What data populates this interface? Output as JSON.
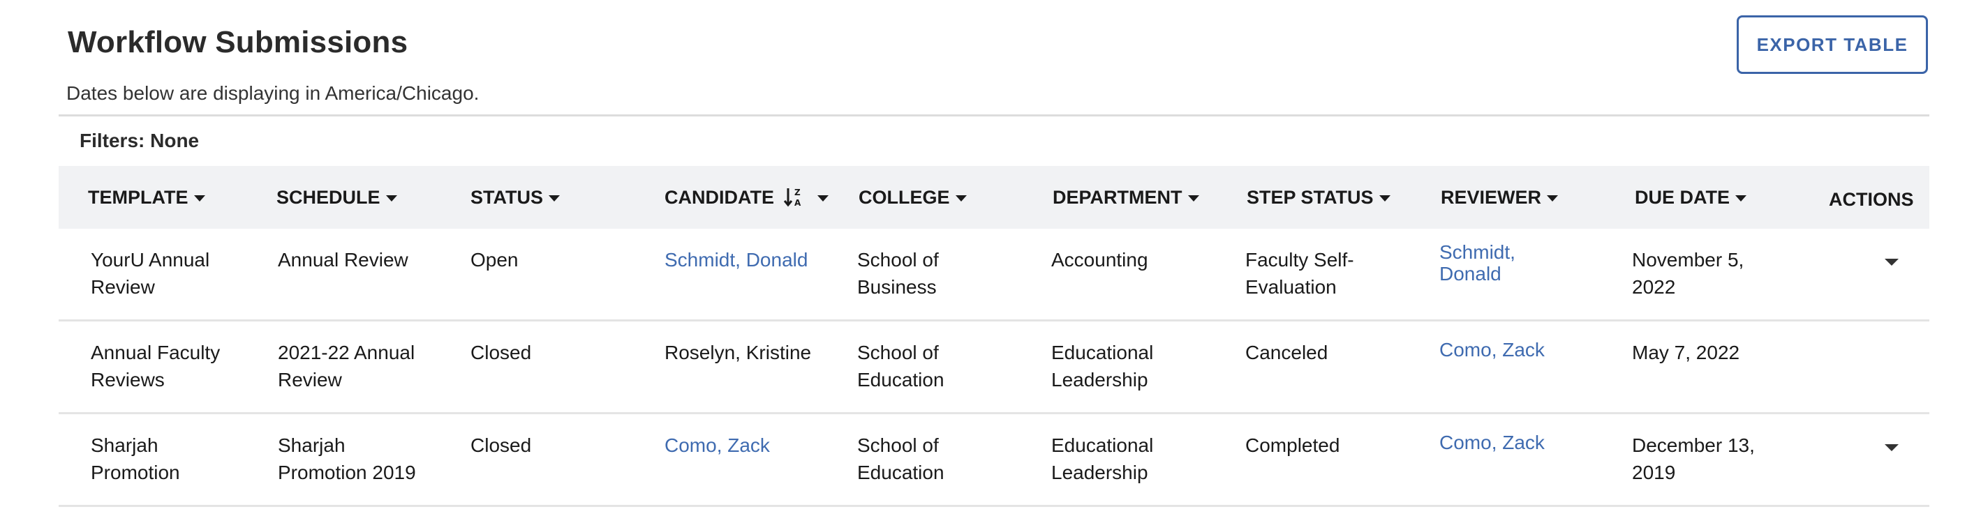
{
  "header": {
    "title": "Workflow Submissions",
    "subtitle": "Dates below are displaying in America/Chicago.",
    "export_label": "EXPORT TABLE",
    "filters_label": "Filters: None"
  },
  "table": {
    "columns": [
      {
        "key": "template",
        "label": "TEMPLATE"
      },
      {
        "key": "schedule",
        "label": "SCHEDULE"
      },
      {
        "key": "status",
        "label": "STATUS"
      },
      {
        "key": "candidate",
        "label": "CANDIDATE",
        "sort": "ascending"
      },
      {
        "key": "college",
        "label": "COLLEGE"
      },
      {
        "key": "department",
        "label": "DEPARTMENT"
      },
      {
        "key": "step_status",
        "label": "STEP STATUS"
      },
      {
        "key": "reviewer",
        "label": "REVIEWER"
      },
      {
        "key": "due_date",
        "label": "DUE DATE"
      },
      {
        "key": "actions",
        "label": "ACTIONS"
      }
    ],
    "rows": [
      {
        "template": [
          "YourU Annual",
          "Review"
        ],
        "schedule": [
          "Annual Review"
        ],
        "status": "Open",
        "candidate": "Schmidt, Donald",
        "candidate_link": true,
        "college": [
          "School of",
          "Business"
        ],
        "department": [
          "Accounting"
        ],
        "step_status": [
          "Faculty Self-",
          "Evaluation"
        ],
        "reviewer": [
          "Schmidt,",
          "Donald"
        ],
        "due_date": [
          "November 5,",
          "2022"
        ],
        "has_actions": true
      },
      {
        "template": [
          "Annual Faculty",
          "Reviews"
        ],
        "schedule": [
          "2021-22 Annual",
          "Review"
        ],
        "status": "Closed",
        "candidate": "Roselyn, Kristine",
        "candidate_link": false,
        "college": [
          "School of",
          "Education"
        ],
        "department": [
          "Educational",
          "Leadership"
        ],
        "step_status": [
          "Canceled"
        ],
        "reviewer": [
          "Como, Zack"
        ],
        "due_date": [
          "May 7, 2022"
        ],
        "has_actions": false
      },
      {
        "template": [
          "Sharjah",
          "Promotion"
        ],
        "schedule": [
          "Sharjah",
          "Promotion 2019"
        ],
        "status": "Closed",
        "candidate": "Como, Zack",
        "candidate_link": true,
        "college": [
          "School of",
          "Education"
        ],
        "department": [
          "Educational",
          "Leadership"
        ],
        "step_status": [
          "Completed"
        ],
        "reviewer": [
          "Como, Zack"
        ],
        "due_date": [
          "December 13,",
          "2019"
        ],
        "has_actions": true
      }
    ]
  },
  "colors": {
    "accent": "#3b64a8",
    "link": "#3f6bb0",
    "header_bg": "#f1f2f4",
    "divider": "#dcdcdc"
  },
  "icons": {
    "sort": "sort-alpha-desc-icon",
    "dropdown": "caret-down-icon",
    "row_action": "caret-down-icon"
  }
}
